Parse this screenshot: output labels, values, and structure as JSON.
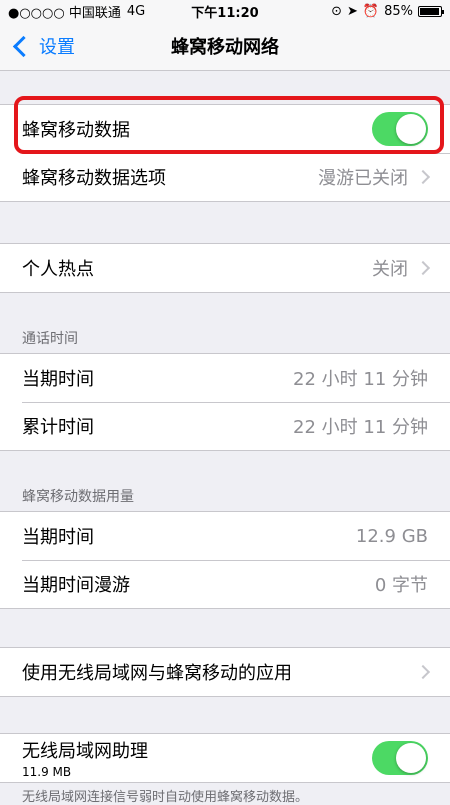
{
  "status_bar": {
    "carrier": "●○○○○ 中国联通",
    "network": "4G",
    "time": "下午11:20",
    "battery": "85%",
    "battery_level": 0.85
  },
  "nav": {
    "back_label": "设置",
    "title": "蜂窝移动网络"
  },
  "section1": {
    "cellular_data_label": "蜂窝移动数据",
    "cellular_data_on": true,
    "options_label": "蜂窝移动数据选项",
    "options_value": "漫游已关闭"
  },
  "section2": {
    "hotspot_label": "个人热点",
    "hotspot_value": "关闭"
  },
  "call_time": {
    "header": "通话时间",
    "current_label": "当期时间",
    "current_value": "22 小时 11 分钟",
    "lifetime_label": "累计时间",
    "lifetime_value": "22 小时 11 分钟"
  },
  "usage": {
    "header": "蜂窝移动数据用量",
    "current_label": "当期时间",
    "current_value": "12.9 GB",
    "roaming_label": "当期时间漫游",
    "roaming_value": "0 字节"
  },
  "apps": {
    "label": "使用无线局域网与蜂窝移动的应用"
  },
  "wifi_assist": {
    "label": "无线局域网助理",
    "sub": "11.9 MB",
    "on": true,
    "footer": "无线局域网连接信号弱时自动使用蜂窝移动数据。"
  },
  "colors": {
    "accent": "#0a7cff",
    "toggle_on": "#4cd964",
    "highlight": "#e4161b"
  }
}
